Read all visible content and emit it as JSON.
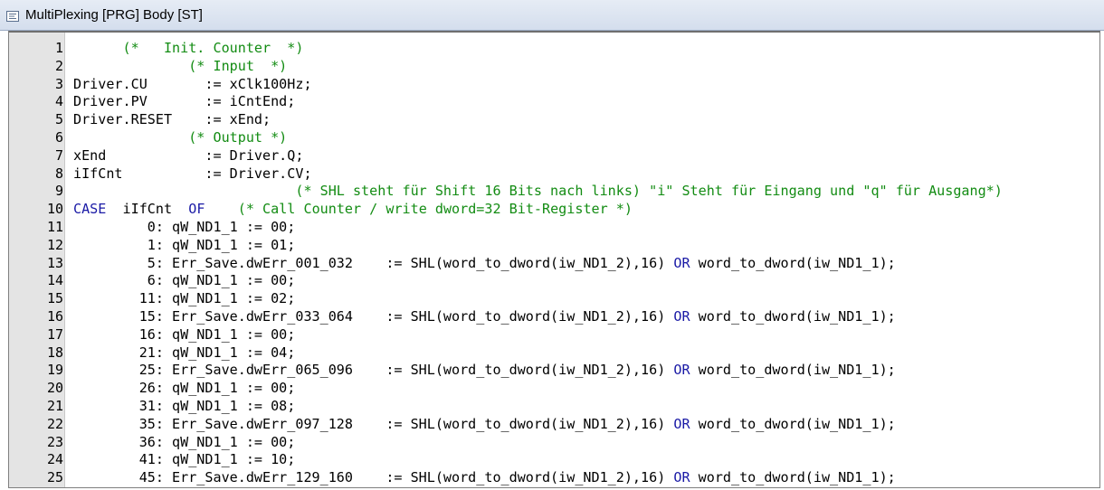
{
  "window": {
    "title": "MultiPlexing [PRG] Body [ST]",
    "icon": "st-body-icon"
  },
  "colors": {
    "keyword": "#1a1aa6",
    "comment": "#138c13",
    "text": "#000000",
    "gutter": "#e4e4e4"
  },
  "editor": {
    "lines": [
      {
        "number": "1",
        "segments": [
          {
            "t": "c",
            "text": "      (*   Init. Counter  *)"
          }
        ]
      },
      {
        "number": "2",
        "segments": [
          {
            "t": "c",
            "text": "              (* Input  *)"
          }
        ]
      },
      {
        "number": "3",
        "segments": [
          {
            "t": "n",
            "text": "Driver.CU       := xClk100Hz;"
          }
        ]
      },
      {
        "number": "4",
        "segments": [
          {
            "t": "n",
            "text": "Driver.PV       := iCntEnd;"
          }
        ]
      },
      {
        "number": "5",
        "segments": [
          {
            "t": "n",
            "text": "Driver.RESET    := xEnd;"
          }
        ]
      },
      {
        "number": "6",
        "segments": [
          {
            "t": "c",
            "text": "              (* Output *)"
          }
        ]
      },
      {
        "number": "7",
        "segments": [
          {
            "t": "n",
            "text": "xEnd            := Driver.Q;"
          }
        ]
      },
      {
        "number": "8",
        "segments": [
          {
            "t": "n",
            "text": "iIfCnt          := Driver.CV;"
          }
        ]
      },
      {
        "number": "9",
        "segments": [
          {
            "t": "c",
            "text": "                           (* SHL steht für Shift 16 Bits nach links) \"i\" Steht für Eingang und \"q\" für Ausgang*)"
          }
        ]
      },
      {
        "number": "10",
        "segments": [
          {
            "t": "k",
            "text": "CASE"
          },
          {
            "t": "n",
            "text": "  iIfCnt  "
          },
          {
            "t": "k",
            "text": "OF"
          },
          {
            "t": "n",
            "text": "    "
          },
          {
            "t": "c",
            "text": "(* Call Counter / write dword=32 Bit-Register *)"
          }
        ]
      },
      {
        "number": "11",
        "segments": [
          {
            "t": "n",
            "text": "         0: qW_ND1_1 := 00;"
          }
        ]
      },
      {
        "number": "12",
        "segments": [
          {
            "t": "n",
            "text": "         1: qW_ND1_1 := 01;"
          }
        ]
      },
      {
        "number": "13",
        "segments": [
          {
            "t": "n",
            "text": "         5: Err_Save.dwErr_001_032    := SHL(word_to_dword(iw_ND1_2),16) "
          },
          {
            "t": "k",
            "text": "OR"
          },
          {
            "t": "n",
            "text": " word_to_dword(iw_ND1_1);"
          }
        ]
      },
      {
        "number": "14",
        "segments": [
          {
            "t": "n",
            "text": "         6: qW_ND1_1 := 00;"
          }
        ]
      },
      {
        "number": "15",
        "segments": [
          {
            "t": "n",
            "text": "        11: qW_ND1_1 := 02;"
          }
        ]
      },
      {
        "number": "16",
        "segments": [
          {
            "t": "n",
            "text": "        15: Err_Save.dwErr_033_064    := SHL(word_to_dword(iw_ND1_2),16) "
          },
          {
            "t": "k",
            "text": "OR"
          },
          {
            "t": "n",
            "text": " word_to_dword(iw_ND1_1);"
          }
        ]
      },
      {
        "number": "17",
        "segments": [
          {
            "t": "n",
            "text": "        16: qW_ND1_1 := 00;"
          }
        ]
      },
      {
        "number": "18",
        "segments": [
          {
            "t": "n",
            "text": "        21: qW_ND1_1 := 04;"
          }
        ]
      },
      {
        "number": "19",
        "segments": [
          {
            "t": "n",
            "text": "        25: Err_Save.dwErr_065_096    := SHL(word_to_dword(iw_ND1_2),16) "
          },
          {
            "t": "k",
            "text": "OR"
          },
          {
            "t": "n",
            "text": " word_to_dword(iw_ND1_1);"
          }
        ]
      },
      {
        "number": "20",
        "segments": [
          {
            "t": "n",
            "text": "        26: qW_ND1_1 := 00;"
          }
        ]
      },
      {
        "number": "21",
        "segments": [
          {
            "t": "n",
            "text": "        31: qW_ND1_1 := 08;"
          }
        ]
      },
      {
        "number": "22",
        "segments": [
          {
            "t": "n",
            "text": "        35: Err_Save.dwErr_097_128    := SHL(word_to_dword(iw_ND1_2),16) "
          },
          {
            "t": "k",
            "text": "OR"
          },
          {
            "t": "n",
            "text": " word_to_dword(iw_ND1_1);"
          }
        ]
      },
      {
        "number": "23",
        "segments": [
          {
            "t": "n",
            "text": "        36: qW_ND1_1 := 00;"
          }
        ]
      },
      {
        "number": "24",
        "segments": [
          {
            "t": "n",
            "text": "        41: qW_ND1_1 := 10;"
          }
        ]
      },
      {
        "number": "25",
        "segments": [
          {
            "t": "n",
            "text": "        45: Err_Save.dwErr_129_160    := SHL(word_to_dword(iw_ND1_2),16) "
          },
          {
            "t": "k",
            "text": "OR"
          },
          {
            "t": "n",
            "text": " word_to_dword(iw_ND1_1);"
          }
        ]
      }
    ]
  }
}
